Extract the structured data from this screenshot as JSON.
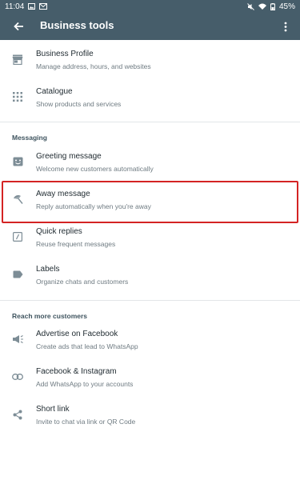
{
  "status_bar": {
    "time": "11:04",
    "battery": "45%"
  },
  "app_bar": {
    "title": "Business tools"
  },
  "items": [
    {
      "title": "Business Profile",
      "subtitle": "Manage address, hours, and websites",
      "icon": "store-icon"
    },
    {
      "title": "Catalogue",
      "subtitle": "Show products and services",
      "icon": "grid-icon"
    },
    {
      "title": "Greeting message",
      "subtitle": "Welcome new customers automatically",
      "icon": "greeting-icon"
    },
    {
      "title": "Away message",
      "subtitle": "Reply automatically when you're away",
      "icon": "beach-umbrella-icon"
    },
    {
      "title": "Quick replies",
      "subtitle": "Reuse frequent messages",
      "icon": "quick-reply-icon"
    },
    {
      "title": "Labels",
      "subtitle": "Organize chats and customers",
      "icon": "label-icon"
    },
    {
      "title": "Advertise on Facebook",
      "subtitle": "Create ads that lead to WhatsApp",
      "icon": "megaphone-icon"
    },
    {
      "title": "Facebook & Instagram",
      "subtitle": "Add WhatsApp to your accounts",
      "icon": "link-icon"
    },
    {
      "title": "Short link",
      "subtitle": "Invite to chat via link or QR Code",
      "icon": "share-icon"
    }
  ],
  "sections": {
    "messaging": "Messaging",
    "reach": "Reach more customers"
  },
  "colors": {
    "app_bar": "#465d6a",
    "icon": "#7d8d96",
    "highlight": "#d42424"
  }
}
